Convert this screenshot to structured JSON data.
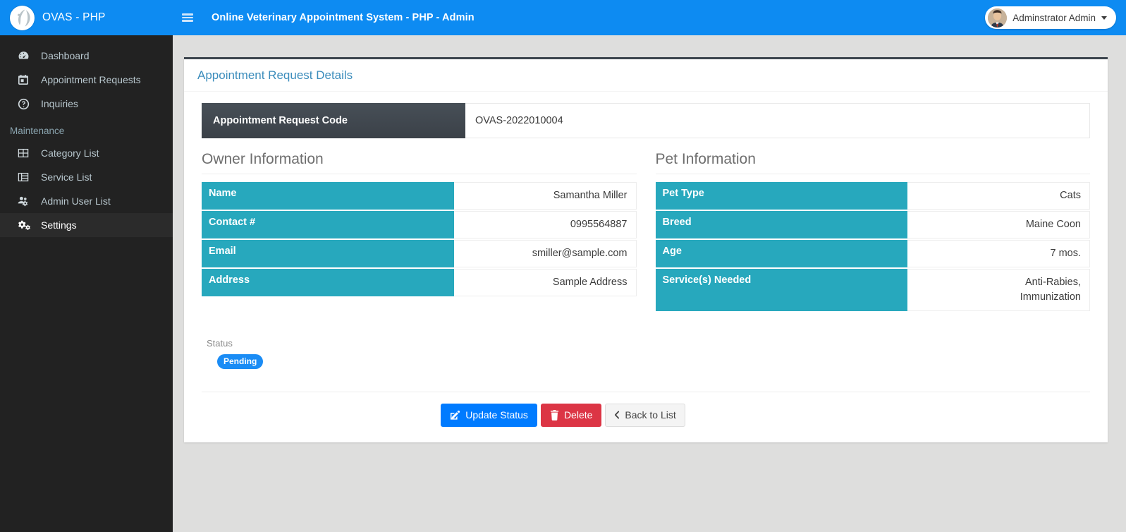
{
  "brand": {
    "logo_icon": "ovas-logo-icon",
    "title": "OVAS - PHP"
  },
  "topbar": {
    "menu_icon": "hamburger-icon",
    "title": "Online Veterinary Appointment System - PHP - Admin",
    "user_name": "Adminstrator Admin",
    "caret_icon": "caret-down-icon",
    "avatar_icon": "user-avatar"
  },
  "sidebar": {
    "items": [
      {
        "label": "Dashboard",
        "icon": "tachometer-icon",
        "active": false
      },
      {
        "label": "Appointment Requests",
        "icon": "calendar-icon",
        "active": false
      },
      {
        "label": "Inquiries",
        "icon": "question-circle-icon",
        "active": false
      }
    ],
    "section_header": "Maintenance",
    "maintenance_items": [
      {
        "label": "Category List",
        "icon": "grid-icon",
        "active": false
      },
      {
        "label": "Service List",
        "icon": "table-list-icon",
        "active": false
      },
      {
        "label": "Admin User List",
        "icon": "users-cog-icon",
        "active": false
      },
      {
        "label": "Settings",
        "icon": "cogs-icon",
        "active": true
      }
    ]
  },
  "card": {
    "title": "Appointment Request Details",
    "code_label": "Appointment Request Code",
    "code_value": "OVAS-2022010004",
    "owner": {
      "section_title": "Owner Information",
      "rows": [
        {
          "label": "Name",
          "value": "Samantha Miller"
        },
        {
          "label": "Contact #",
          "value": "0995564887"
        },
        {
          "label": "Email",
          "value": "smiller@sample.com"
        },
        {
          "label": "Address",
          "value": "Sample Address"
        }
      ]
    },
    "pet": {
      "section_title": "Pet Information",
      "rows": [
        {
          "label": "Pet Type",
          "value": "Cats"
        },
        {
          "label": "Breed",
          "value": "Maine Coon"
        },
        {
          "label": "Age",
          "value": "7 mos."
        },
        {
          "label": "Service(s) Needed",
          "value": "Anti-Rabies,\nImmunization"
        }
      ]
    },
    "status_label": "Status",
    "status_value": "Pending",
    "buttons": [
      {
        "label": "Update Status",
        "icon": "edit-icon",
        "style": "primary"
      },
      {
        "label": "Delete",
        "icon": "trash-icon",
        "style": "danger"
      },
      {
        "label": "Back to List",
        "icon": "chevron-left-icon",
        "style": "default"
      }
    ]
  },
  "colors": {
    "brand_blue": "#0d8bf2",
    "sidebar_dark": "#222222",
    "table_header_teal": "#27a8bd",
    "card_top_border": "#3c444d",
    "status_badge": "#1a8cf5",
    "btn_primary": "#007bff",
    "btn_danger": "#dc3545",
    "page_bg": "#dededd",
    "card_title": "#3c8dbc"
  }
}
